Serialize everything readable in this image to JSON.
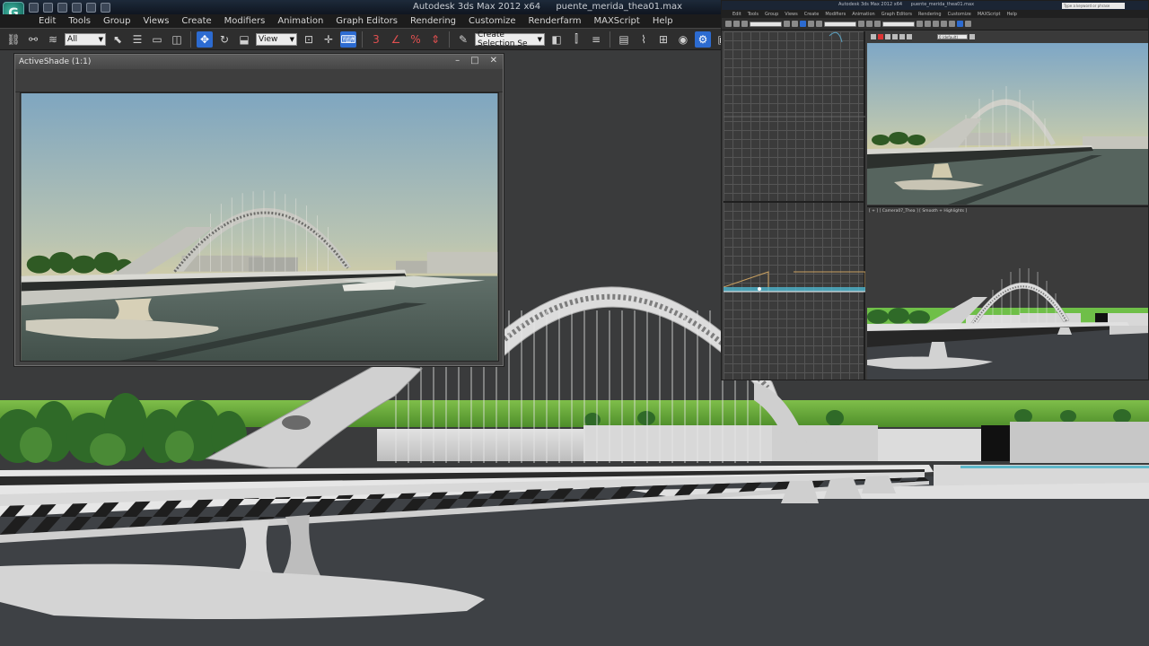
{
  "titlebar": {
    "app_title": "Autodesk 3ds Max  2012 x64",
    "file_name": "puente_merida_thea01.max",
    "logo_glyph": "G"
  },
  "menubar": {
    "items": [
      "Edit",
      "Tools",
      "Group",
      "Views",
      "Create",
      "Modifiers",
      "Animation",
      "Graph Editors",
      "Rendering",
      "Customize",
      "Renderfarm",
      "MAXScript",
      "Help"
    ]
  },
  "toolbar": {
    "selection_filter": "All",
    "reference_coord": "View",
    "named_selection": "Create Selection Se"
  },
  "activeshade": {
    "title": "ActiveShade (1:1)",
    "controls": {
      "minimize": "–",
      "maximize": "□",
      "close": "✕"
    }
  },
  "secondary_window": {
    "title": "Autodesk 3ds Max  2012 x64",
    "file_name": "puente_merida_thea01.max",
    "help_search": "Type a keyword or phrase",
    "menu": [
      "Edit",
      "Tools",
      "Group",
      "Views",
      "Create",
      "Modifiers",
      "Animation",
      "Graph Editors",
      "Rendering",
      "Customize",
      "MAXScript",
      "Help"
    ],
    "camera_label": "[ + ] [ Camera07_Thea ] [ Smooth + Highlights ]",
    "layer_dropdown": "0 (default)"
  },
  "colors": {
    "ui_dark": "#2e2e2e",
    "viewport_bg": "#3a3b3c",
    "selection_blue": "#2c6bd1",
    "sky_top": "#7fa6c0",
    "sky_horizon": "#d9cfa4"
  }
}
